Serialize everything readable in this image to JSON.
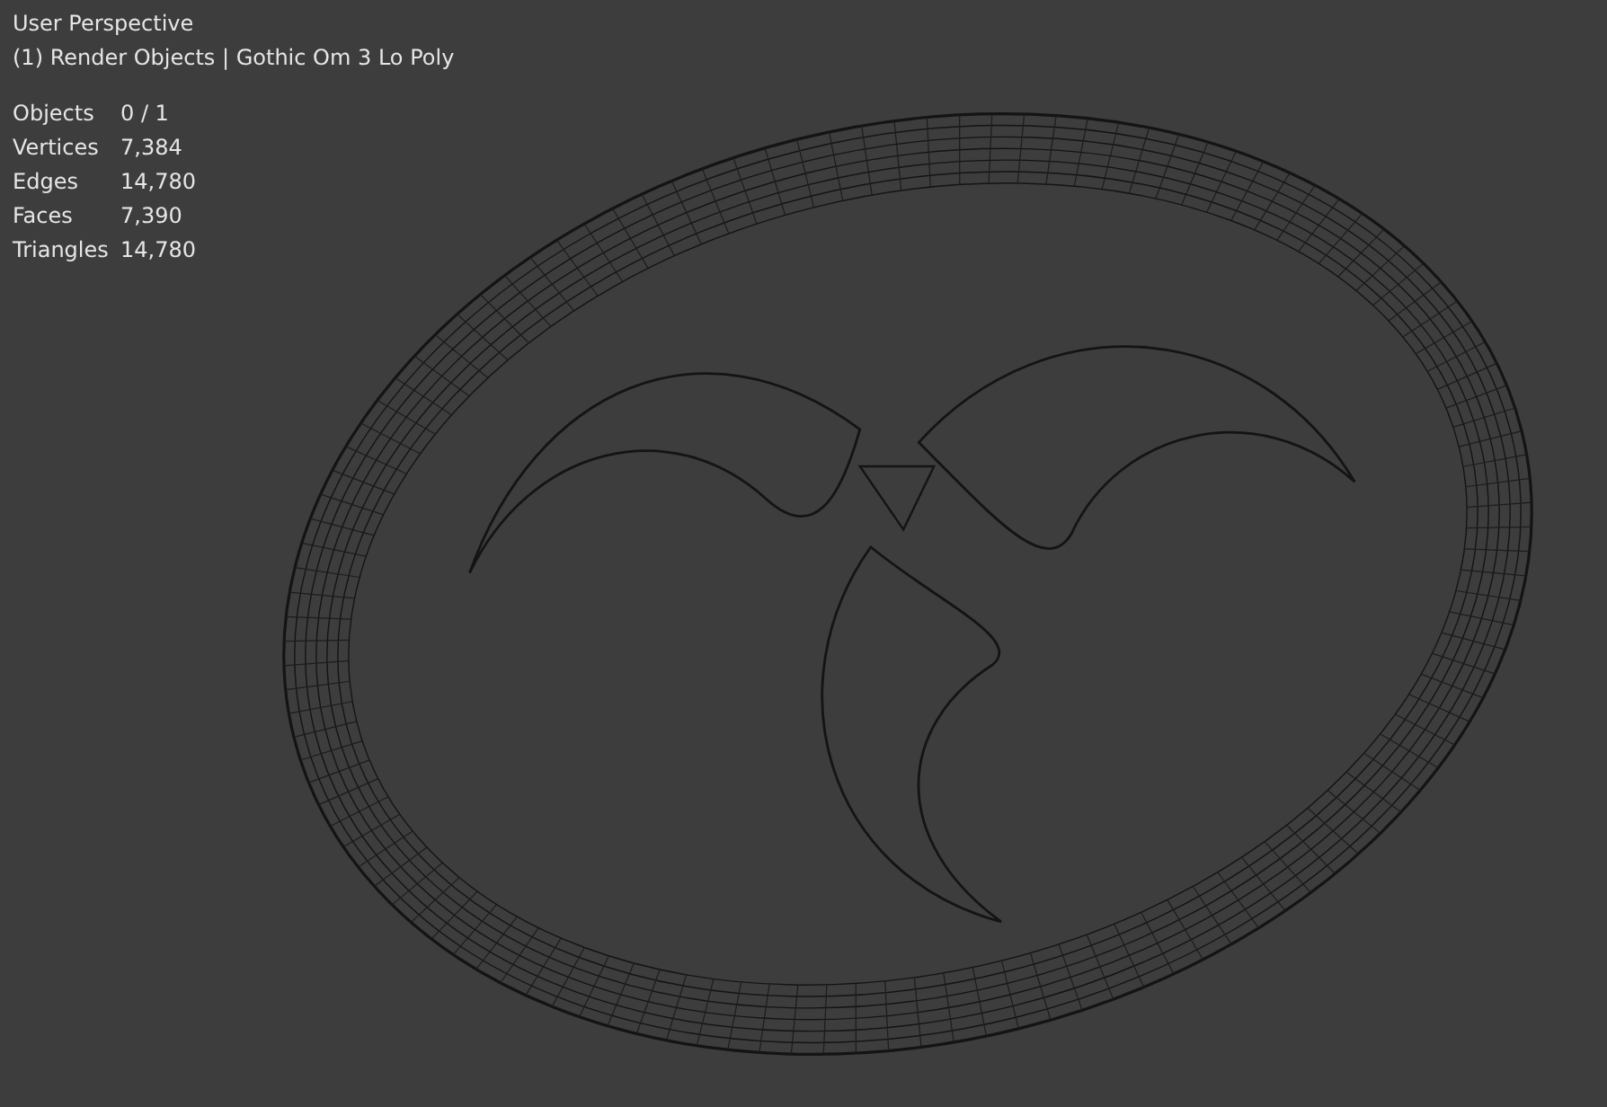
{
  "viewport": {
    "view_name": "User Perspective",
    "collection_info": "(1) Render Objects | Gothic Om 3 Lo Poly",
    "stats": [
      {
        "label": "Objects",
        "value": "0 / 1"
      },
      {
        "label": "Vertices",
        "value": "7,384"
      },
      {
        "label": "Edges",
        "value": "14,780"
      },
      {
        "label": "Faces",
        "value": "7,390"
      },
      {
        "label": "Triangles",
        "value": "14,780"
      }
    ]
  }
}
